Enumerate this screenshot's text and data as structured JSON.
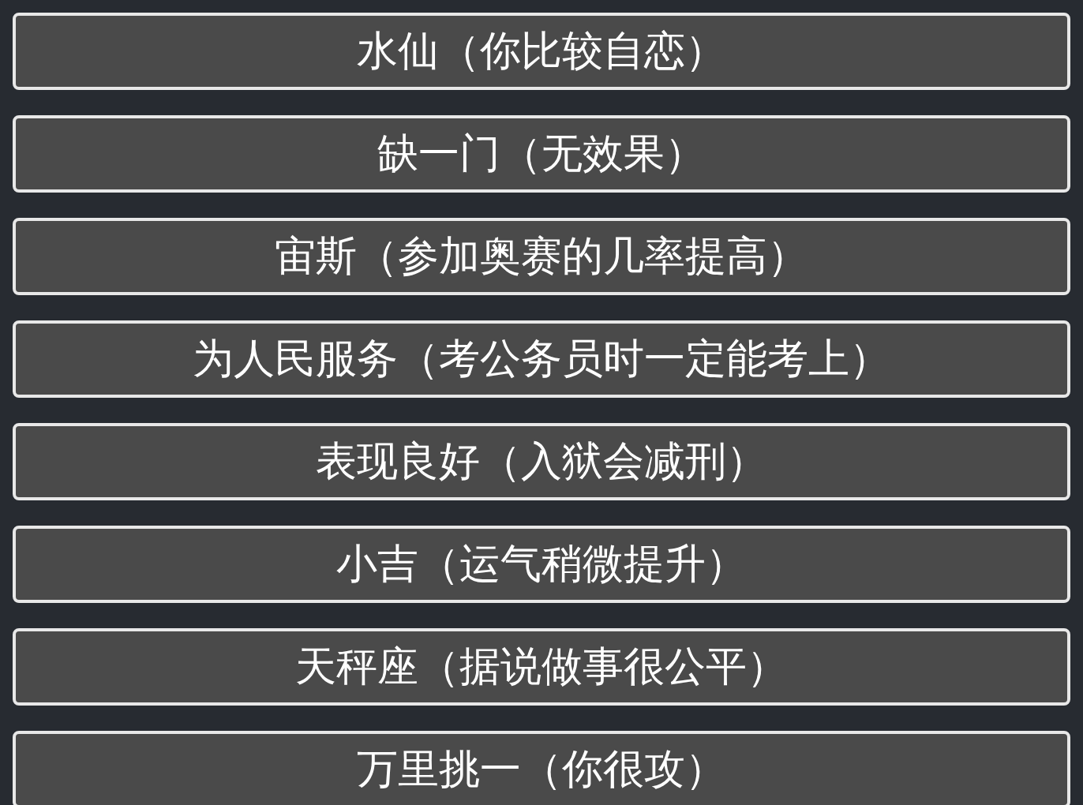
{
  "options": [
    {
      "label": "水仙（你比较自恋）"
    },
    {
      "label": "缺一门（无效果）"
    },
    {
      "label": "宙斯（参加奥赛的几率提高）"
    },
    {
      "label": "为人民服务（考公务员时一定能考上）"
    },
    {
      "label": "表现良好（入狱会减刑）"
    },
    {
      "label": "小吉（运气稍微提升）"
    },
    {
      "label": "天秤座（据说做事很公平）"
    },
    {
      "label": "万里挑一（你很攻）"
    }
  ]
}
